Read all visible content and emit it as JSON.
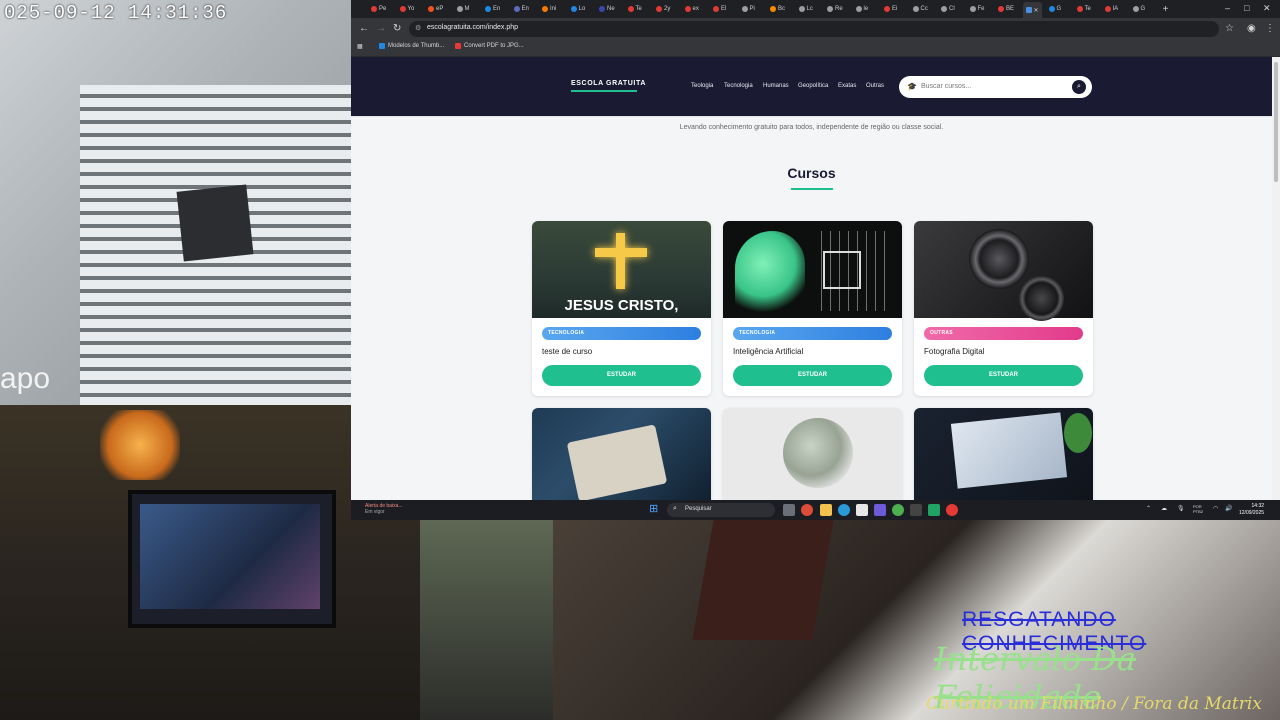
{
  "camera": {
    "timestamp": "025-09-12  14:31:36",
    "brand_logo": "apo"
  },
  "overlays": {
    "line1": "RESGATANDO CONHECIMENTO",
    "line2": "Intervalo Da Felicidade",
    "line3": "Curtindo um Filminho / Fora da Matrix"
  },
  "browser": {
    "tabs": [
      {
        "label": "Pe",
        "color": "#e53935"
      },
      {
        "label": "Yo",
        "color": "#e53935"
      },
      {
        "label": "eP",
        "color": "#f4511e"
      },
      {
        "label": "M",
        "color": "#9e9e9e"
      },
      {
        "label": "En",
        "color": "#1e88e5"
      },
      {
        "label": "En",
        "color": "#5c6bc0"
      },
      {
        "label": "Ini",
        "color": "#f57c00"
      },
      {
        "label": "Lo",
        "color": "#1e88e5"
      },
      {
        "label": "Ne",
        "color": "#3949ab"
      },
      {
        "label": "Te",
        "color": "#e53935"
      },
      {
        "label": "2y",
        "color": "#e53935"
      },
      {
        "label": "ex",
        "color": "#e53935"
      },
      {
        "label": "El",
        "color": "#e53935"
      },
      {
        "label": "Pi",
        "color": "#9e9e9e"
      },
      {
        "label": "Bc",
        "color": "#fb8c00"
      },
      {
        "label": "Lc",
        "color": "#9e9e9e"
      },
      {
        "label": "Re",
        "color": "#9e9e9e"
      },
      {
        "label": "le",
        "color": "#9e9e9e"
      },
      {
        "label": "Ei",
        "color": "#e53935"
      },
      {
        "label": "Cc",
        "color": "#9e9e9e"
      },
      {
        "label": "Cl",
        "color": "#9e9e9e"
      },
      {
        "label": "Fe",
        "color": "#9e9e9e"
      },
      {
        "label": "BE",
        "color": "#e53935"
      }
    ],
    "active_tab_close": "✕",
    "tabs_after": [
      {
        "label": "G",
        "color": "#1e88e5"
      },
      {
        "label": "Te",
        "color": "#e53935"
      },
      {
        "label": "IA",
        "color": "#e53935"
      },
      {
        "label": "G",
        "color": "#9e9e9e"
      }
    ],
    "new_tab": "+",
    "window_controls": {
      "minimize": "–",
      "maximize": "□",
      "close": "✕"
    },
    "url": "escolagratuita.com/index.php",
    "bookmarks": [
      {
        "label": "Modelos de Thumb...",
        "color": "#1e88e5"
      },
      {
        "label": "Convert PDF to JPG...",
        "color": "#e53935"
      }
    ]
  },
  "site": {
    "brand": "ESCOLA GRATUITA",
    "menu": [
      "Teologia",
      "Tecnologia",
      "Humanas",
      "Geopolítica",
      "Exatas",
      "Outras"
    ],
    "search_placeholder": "Buscar cursos...",
    "tagline": "Levando conhecimento gratuito para todos, independente de região ou classe social.",
    "heading": "Cursos",
    "study_label": "ESTUDAR",
    "courses": [
      {
        "category": "TECNOLOGIA",
        "category_color": "#3b8ee8",
        "title": "teste de curso",
        "image_text": "JESUS CRISTO,"
      },
      {
        "category": "TECNOLOGIA",
        "category_color": "#3b8ee8",
        "title": "Inteligência Artificial"
      },
      {
        "category": "OUTRAS",
        "category_color": "#e8499a",
        "title": "Fotografia Digital"
      }
    ]
  },
  "taskbar": {
    "notification_title": "Alerta de baixa...",
    "notification_sub": "Em vigor",
    "search_label": "Pesquisar",
    "lang_top": "POR",
    "lang_bottom": "PTB2",
    "time": "14:32",
    "date": "12/09/2025"
  },
  "colors": {
    "header_bg": "#1a1b33",
    "accent_green": "#1fbf8f"
  }
}
